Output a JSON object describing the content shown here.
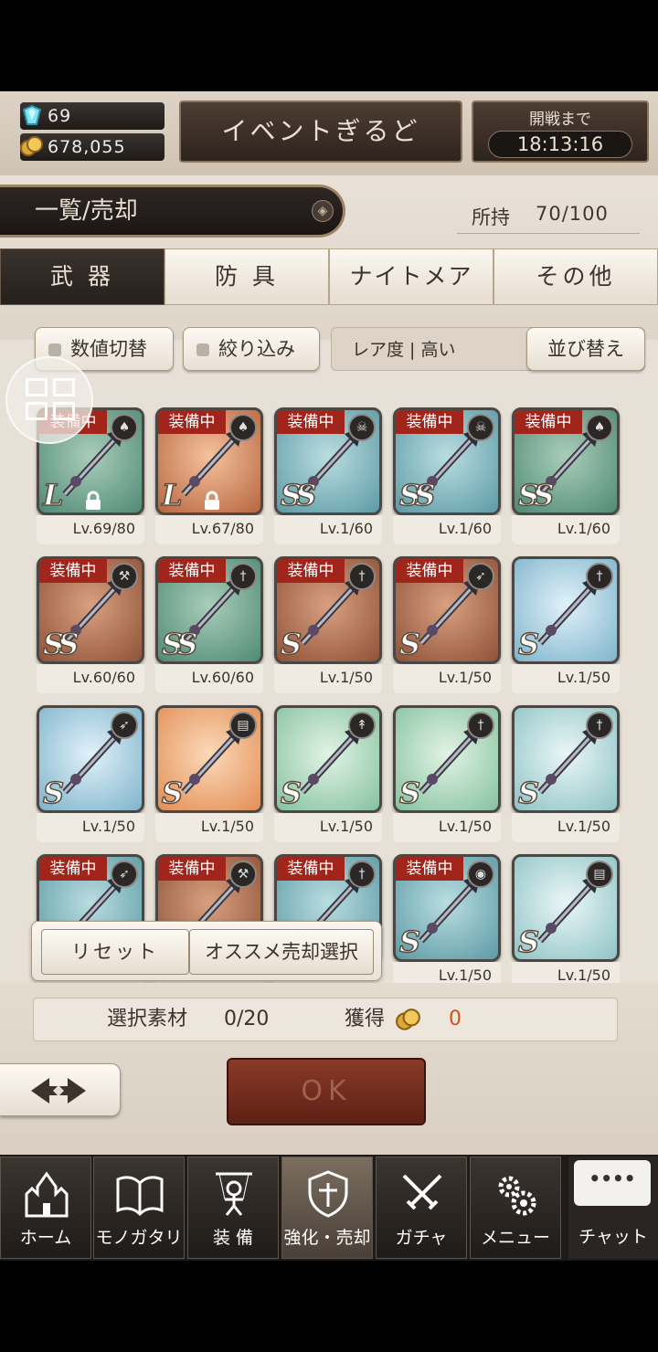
{
  "header": {
    "gems": "69",
    "coins": "678,055",
    "event_button": "イベントぎるど",
    "battle_label": "開戦まで",
    "battle_timer": "18:13:16"
  },
  "list": {
    "title": "一覧/売却",
    "owned_label": "所持",
    "owned_value": "70/100"
  },
  "tabs": [
    "武 器",
    "防 具",
    "ナイトメア",
    "その他"
  ],
  "filters": {
    "toggle_values": "数値切替",
    "narrow": "絞り込み",
    "sort_label": "レア度 | 高い",
    "sort_button": "並び替え"
  },
  "equipped_badge": "装備中",
  "items": [
    {
      "level": "Lv.69/80",
      "rarity": "L",
      "equipped": true,
      "locked": true,
      "color": "green",
      "icon": "mace-icon"
    },
    {
      "level": "Lv.67/80",
      "rarity": "L",
      "equipped": true,
      "locked": true,
      "color": "orange",
      "icon": "mace-icon"
    },
    {
      "level": "Lv.1/60",
      "rarity": "SS",
      "equipped": true,
      "locked": false,
      "color": "teal",
      "icon": "skull-icon"
    },
    {
      "level": "Lv.1/60",
      "rarity": "SS",
      "equipped": true,
      "locked": false,
      "color": "teal",
      "icon": "skull-icon"
    },
    {
      "level": "Lv.1/60",
      "rarity": "SS",
      "equipped": true,
      "locked": false,
      "color": "green",
      "icon": "mace-icon"
    },
    {
      "level": "Lv.60/60",
      "rarity": "SS",
      "equipped": true,
      "locked": false,
      "color": "brown",
      "icon": "hammer-icon"
    },
    {
      "level": "Lv.60/60",
      "rarity": "SS",
      "equipped": true,
      "locked": false,
      "color": "green",
      "icon": "sword-icon"
    },
    {
      "level": "Lv.1/50",
      "rarity": "S",
      "equipped": true,
      "locked": false,
      "color": "brown",
      "icon": "sword-icon"
    },
    {
      "level": "Lv.1/50",
      "rarity": "S",
      "equipped": true,
      "locked": false,
      "color": "brown",
      "icon": "bow-icon"
    },
    {
      "level": "Lv.1/50",
      "rarity": "S",
      "equipped": false,
      "locked": false,
      "color": "blue",
      "icon": "sword-icon"
    },
    {
      "level": "Lv.1/50",
      "rarity": "S",
      "equipped": false,
      "locked": false,
      "color": "blue",
      "icon": "bow-icon"
    },
    {
      "level": "Lv.1/50",
      "rarity": "S",
      "equipped": false,
      "locked": false,
      "color": "peach",
      "icon": "book-icon"
    },
    {
      "level": "Lv.1/50",
      "rarity": "S",
      "equipped": false,
      "locked": false,
      "color": "mint",
      "icon": "spear-icon"
    },
    {
      "level": "Lv.1/50",
      "rarity": "S",
      "equipped": false,
      "locked": false,
      "color": "mint",
      "icon": "sword-icon"
    },
    {
      "level": "Lv.1/50",
      "rarity": "S",
      "equipped": false,
      "locked": false,
      "color": "light",
      "icon": "sword-icon"
    },
    {
      "level": "",
      "rarity": "S",
      "equipped": true,
      "locked": false,
      "color": "teal",
      "icon": "bow-icon"
    },
    {
      "level": "",
      "rarity": "S",
      "equipped": true,
      "locked": false,
      "color": "brown",
      "icon": "hammer-icon"
    },
    {
      "level": "",
      "rarity": "S",
      "equipped": true,
      "locked": false,
      "color": "teal",
      "icon": "sword-icon"
    },
    {
      "level": "Lv.1/50",
      "rarity": "S",
      "equipped": true,
      "locked": false,
      "color": "teal",
      "icon": "orb-icon"
    },
    {
      "level": "Lv.1/50",
      "rarity": "S",
      "equipped": false,
      "locked": false,
      "color": "light",
      "icon": "book-icon"
    }
  ],
  "popup": {
    "reset": "リセット",
    "recommend": "オススメ売却選択"
  },
  "selection": {
    "material_label": "選択素材",
    "material_value": "0/20",
    "gain_label": "獲得",
    "gain_value": "0"
  },
  "ok_button": "OK",
  "nav": [
    {
      "label": "ホーム",
      "icon": "castle-icon"
    },
    {
      "label": "モノガタリ",
      "icon": "book-icon"
    },
    {
      "label": "装 備",
      "icon": "puppet-icon"
    },
    {
      "label": "強化・売却",
      "icon": "shield-icon"
    },
    {
      "label": "ガチャ",
      "icon": "crossed-swords-icon"
    },
    {
      "label": "メニュー",
      "icon": "gears-icon"
    }
  ],
  "chat": {
    "label": "チャット",
    "bubble": "••••"
  },
  "colors": {
    "equipped_red": "#a2251c",
    "gain_orange": "#d0521c",
    "ok_brown": "#6e2a1b"
  }
}
